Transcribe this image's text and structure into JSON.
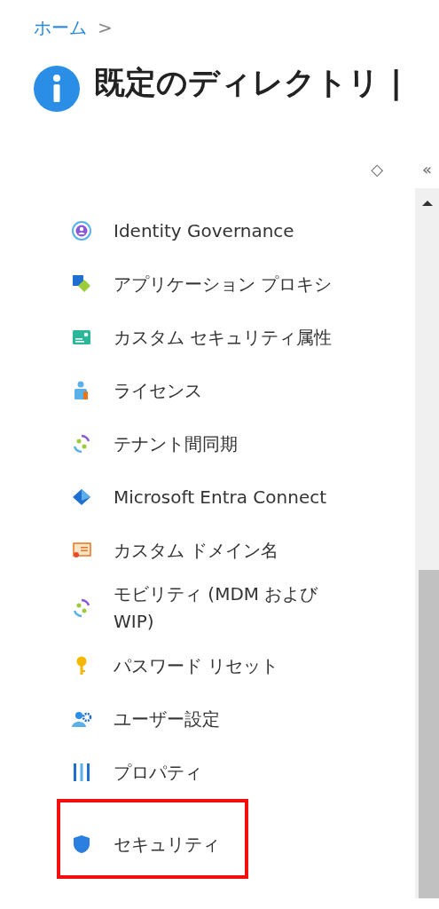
{
  "breadcrumb": {
    "items": [
      "ホーム"
    ],
    "separator": ">"
  },
  "page_title": "既定のディレクトリ |",
  "toolbar": {
    "sort_symbol": "◇",
    "collapse_symbol": "«"
  },
  "sidebar": {
    "items": [
      {
        "label": "Identity Governance",
        "highlighted": false
      },
      {
        "label": "アプリケーション プロキシ",
        "highlighted": false
      },
      {
        "label": "カスタム セキュリティ属性",
        "highlighted": false
      },
      {
        "label": "ライセンス",
        "highlighted": false
      },
      {
        "label": "テナント間同期",
        "highlighted": false
      },
      {
        "label": "Microsoft Entra Connect",
        "highlighted": false
      },
      {
        "label": "カスタム ドメイン名",
        "highlighted": false
      },
      {
        "label": "モビリティ (MDM および WIP)",
        "highlighted": false
      },
      {
        "label": "パスワード リセット",
        "highlighted": false
      },
      {
        "label": "ユーザー設定",
        "highlighted": false
      },
      {
        "label": "プロパティ",
        "highlighted": false
      },
      {
        "label": "セキュリティ",
        "highlighted": true
      }
    ]
  }
}
